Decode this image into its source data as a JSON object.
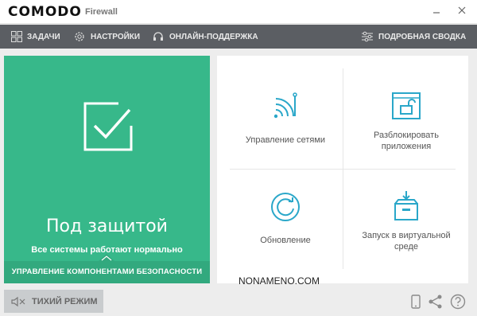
{
  "titlebar": {
    "logo": "COMODO",
    "product": "Firewall"
  },
  "toolbar": {
    "tasks": "ЗАДАЧИ",
    "settings": "НАСТРОЙКИ",
    "support": "ОНЛАЙН-ПОДДЕРЖКА",
    "summary": "ПОДРОБНАЯ СВОДКА"
  },
  "status": {
    "title": "Под защитой",
    "subtitle": "Все системы работают нормально",
    "manage": "УПРАВЛЕНИЕ КОМПОНЕНТАМИ БЕЗОПАСНОСТИ"
  },
  "tiles": {
    "network": "Управление сетями",
    "unblock": "Разблокировать приложения",
    "update": "Обновление",
    "virtual": "Запуск в виртуальной среде"
  },
  "watermark": "NONAMENO.COM",
  "footer": {
    "quiet_mode": "ТИХИЙ РЕЖИМ"
  },
  "colors": {
    "accent_green": "#37b88a",
    "icon_teal": "#2aa7c9",
    "toolbar": "#5b5e63"
  }
}
